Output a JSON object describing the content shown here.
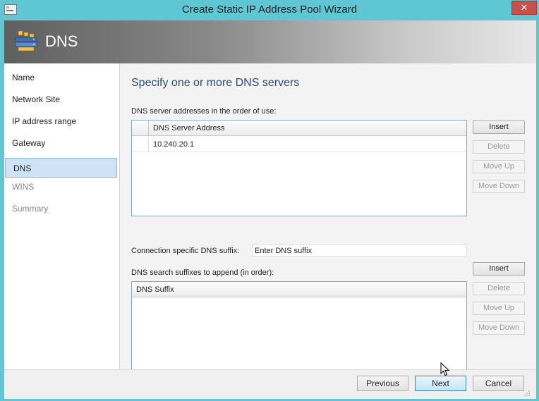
{
  "window": {
    "title": "Create Static IP Address Pool Wizard",
    "close_label": "✕"
  },
  "banner": {
    "title": "DNS",
    "icon": "dns-server-icon"
  },
  "sidebar": {
    "items": [
      {
        "label": "Name",
        "state": "normal"
      },
      {
        "label": "Network Site",
        "state": "normal"
      },
      {
        "label": "IP address range",
        "state": "normal"
      },
      {
        "label": "Gateway",
        "state": "normal"
      },
      {
        "label": "DNS",
        "state": "active"
      },
      {
        "label": "WINS",
        "state": "disabled"
      },
      {
        "label": "Summary",
        "state": "disabled"
      }
    ]
  },
  "main": {
    "heading": "Specify one or more DNS servers",
    "dns_servers_label": "DNS server addresses in the order of use:",
    "dns_servers": {
      "column_header": "DNS Server Address",
      "rows": [
        "10.240.20.1"
      ],
      "buttons": {
        "insert": "Insert",
        "delete": "Delete",
        "move_up": "Move Up",
        "move_down": "Move Down"
      }
    },
    "suffix_label": "Connection specific DNS suffix:",
    "suffix_placeholder": "Enter DNS suffix",
    "search_suffixes_label": "DNS search suffixes to append (in order):",
    "search_suffixes": {
      "column_header": "DNS Suffix",
      "rows": [],
      "buttons": {
        "insert": "Insert",
        "delete": "Delete",
        "move_up": "Move Up",
        "move_down": "Move Down"
      }
    }
  },
  "footer": {
    "previous": "Previous",
    "next": "Next",
    "cancel": "Cancel"
  },
  "colors": {
    "window_frame": "#5ec7d3",
    "heading": "#2a4e7a",
    "active_nav": "#cfe3f7",
    "close_button": "#c7504b"
  }
}
